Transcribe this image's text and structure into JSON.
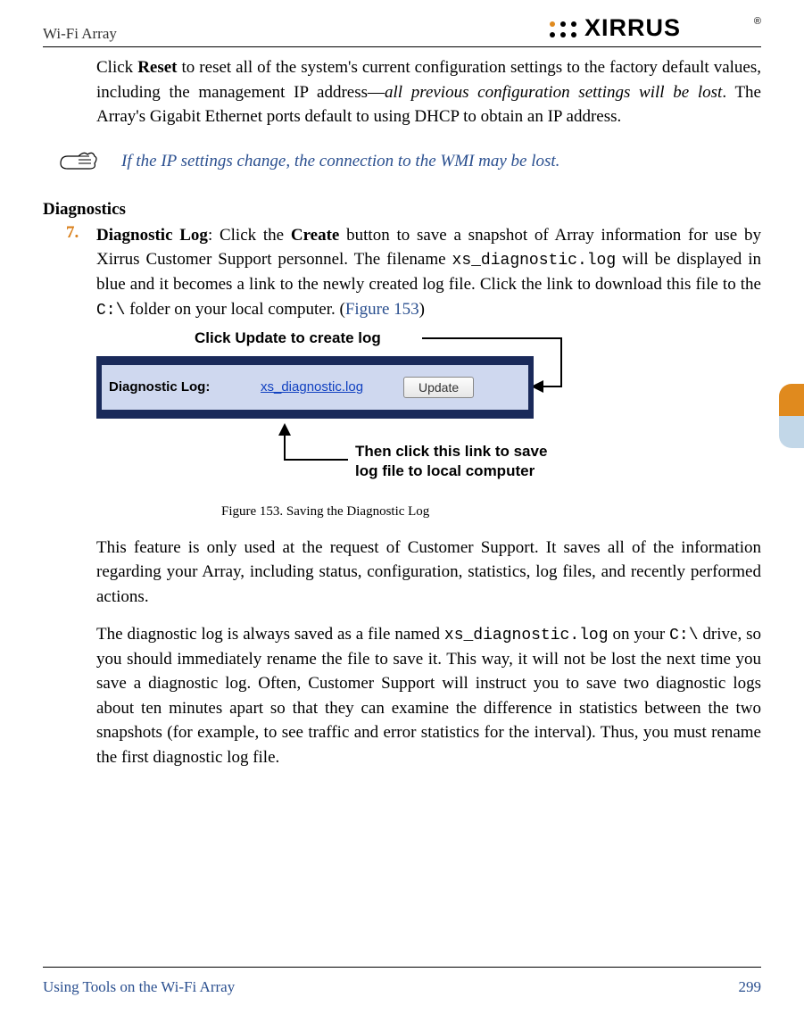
{
  "header": {
    "doc_title": "Wi-Fi Array",
    "logo_text": "XIRRUS",
    "logo_reg": "®"
  },
  "body": {
    "p1_a": "Click ",
    "p1_reset": "Reset",
    "p1_b": " to reset all of the system's current configuration settings to the factory default values, including the management IP address—",
    "p1_italic": "all previous configuration settings will be lost",
    "p1_c": ". The Array's Gigabit Ethernet ports default to using DHCP to obtain an IP address.",
    "note": "If the IP settings change, the connection to the WMI may be lost.",
    "h2": "Diagnostics",
    "item7_num": "7.",
    "item7_a": "Diagnostic Log",
    "item7_b": ": Click the ",
    "item7_create": "Create",
    "item7_c": " button to save a snapshot of Array information for use by Xirrus Customer Support personnel. The filename ",
    "item7_file": "xs_diagnostic.log",
    "item7_d": " will be displayed in blue and it becomes a link to the newly created log file. Click the link to download this file to the ",
    "item7_path": "C:\\",
    "item7_e": " folder on your local computer. (",
    "item7_figref": "Figure 153",
    "item7_f": ")",
    "p3_a": "This feature is only used at the request of Customer Support. It saves all of the information regarding your Array, including status, configuration, statistics, log files, and recently performed actions.",
    "p4_a": "The diagnostic log is always saved as a file named ",
    "p4_file": "xs_diagnostic.log",
    "p4_b": " on your ",
    "p4_path": "C:\\",
    "p4_c": " drive, so you should immediately rename the file to save it. This way, it will not be lost the next time you save a diagnostic log. Often, Customer Support will instruct you to save two diagnostic logs about ten minutes apart so that they can examine the difference in statistics between the two snapshots (for example, to see traffic and error statistics for the interval). Thus, you must rename the first diagnostic log file."
  },
  "figure": {
    "ann1": "Click Update to create log",
    "ss_label": "Diagnostic Log:",
    "ss_link": "xs_diagnostic.log",
    "ss_button": "Update",
    "ann2_a": "Then click this link to save",
    "ann2_b": "log file to local computer",
    "caption": "Figure 153. Saving the Diagnostic Log"
  },
  "footer": {
    "section": "Using Tools on the Wi-Fi Array",
    "page": "299"
  }
}
